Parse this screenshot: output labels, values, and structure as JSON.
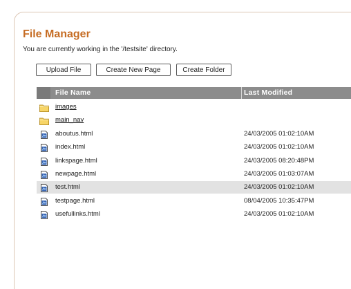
{
  "header": {
    "title": "File Manager",
    "subtitle": "You are currently working in the '/testsite' directory."
  },
  "toolbar": {
    "buttons": [
      "Upload File",
      "Create New Page",
      "Create Folder"
    ]
  },
  "table": {
    "columns": [
      "File Name",
      "Last Modified"
    ],
    "rows": [
      {
        "name": "images",
        "type": "folder",
        "modified": ""
      },
      {
        "name": "main_nav",
        "type": "folder",
        "modified": ""
      },
      {
        "name": "aboutus.html",
        "type": "file",
        "modified": "24/03/2005 01:02:10AM"
      },
      {
        "name": "index.html",
        "type": "file",
        "modified": "24/03/2005 01:02:10AM"
      },
      {
        "name": "linkspage.html",
        "type": "file",
        "modified": "24/03/2005 08:20:48PM"
      },
      {
        "name": "newpage.html",
        "type": "file",
        "modified": "24/03/2005 01:03:07AM"
      },
      {
        "name": "test.html",
        "type": "file",
        "modified": "24/03/2005 01:02:10AM",
        "highlighted": true
      },
      {
        "name": "testpage.html",
        "type": "file",
        "modified": "08/04/2005 10:35:47PM"
      },
      {
        "name": "usefullinks.html",
        "type": "file",
        "modified": "24/03/2005 01:02:10AM"
      }
    ]
  },
  "colors": {
    "title": "#c66d24",
    "panel_border": "#dcc6b4",
    "header_bg": "#8c8c8c",
    "highlight_row": "#e2e2e2",
    "folder_icon": "#f7d567",
    "file_icon": "#3a67b5"
  },
  "icons": {
    "folder": "folder-icon",
    "file": "html-file-icon"
  }
}
